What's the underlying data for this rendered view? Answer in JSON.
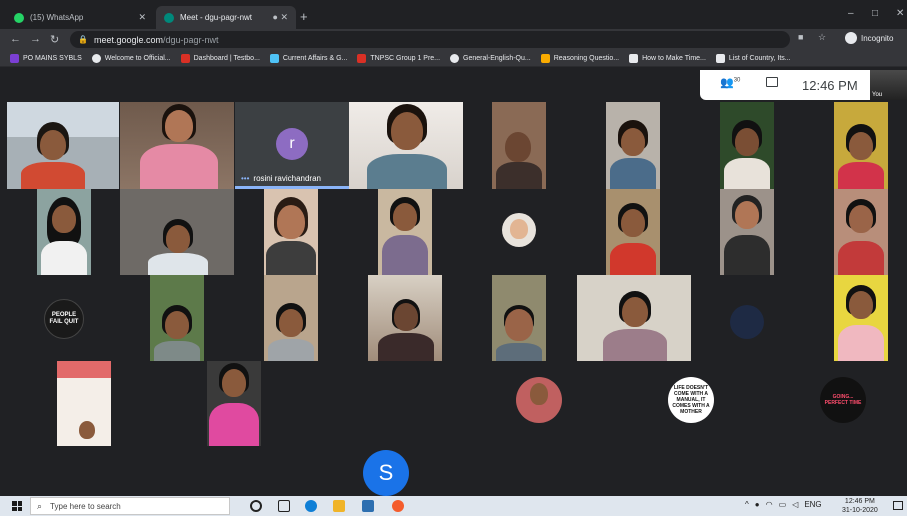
{
  "browser": {
    "tabs": [
      {
        "label": "(15) WhatsApp",
        "icon": "whatsapp-icon",
        "active": false
      },
      {
        "label": "Meet - dgu-pagr-nwt",
        "icon": "meet-icon",
        "active": true
      }
    ],
    "new_tab": "+",
    "window_controls": [
      "–",
      "□",
      "✕"
    ],
    "url_host": "meet.google.com",
    "url_path": "/dgu-pagr-nwt",
    "incognito_label": "Incognito",
    "bookmarks": [
      {
        "label": "PO MAINS SYBLS",
        "color": "#7b3fd4"
      },
      {
        "label": "Welcome to Official...",
        "color": "#e8eaed"
      },
      {
        "label": "Dashboard | Testbo...",
        "color": "#d93025"
      },
      {
        "label": "Current Affairs & G...",
        "color": "#4fc3f7"
      },
      {
        "label": "TNPSC Group 1 Pre...",
        "color": "#d93025"
      },
      {
        "label": "General-English-Qu...",
        "color": "#e8eaed"
      },
      {
        "label": "Reasoning Questio...",
        "color": "#f9ab00"
      },
      {
        "label": "How to Make Time...",
        "color": "#e8eaed"
      },
      {
        "label": "List of Country, Its...",
        "color": "#e8eaed"
      }
    ]
  },
  "meet": {
    "participant_count": "30",
    "clock": "12:46 PM",
    "self_label": "You",
    "speaker_initial": "r",
    "speaker_name": "rosini ravichandran",
    "speaker_dots": "•••",
    "s_initial": "S",
    "badges": [
      {
        "text": "PEOPLE FAIL QUIT"
      },
      {
        "text": "LIFE DOESN'T COME WITH A MANUAL, IT COMES WITH A MOTHER"
      },
      {
        "text": "GOING... PERFECT TIME"
      }
    ]
  },
  "taskbar": {
    "search_placeholder": "Type here to search",
    "tray_lang": "ENG",
    "time": "12:46 PM",
    "date": "31-10-2020"
  },
  "colors": {
    "meet_bg": "#202124",
    "speaker_avatar": "#8d6cc2",
    "s_avatar": "#1a73e8",
    "speaking_bar": "#8ab4f8"
  }
}
